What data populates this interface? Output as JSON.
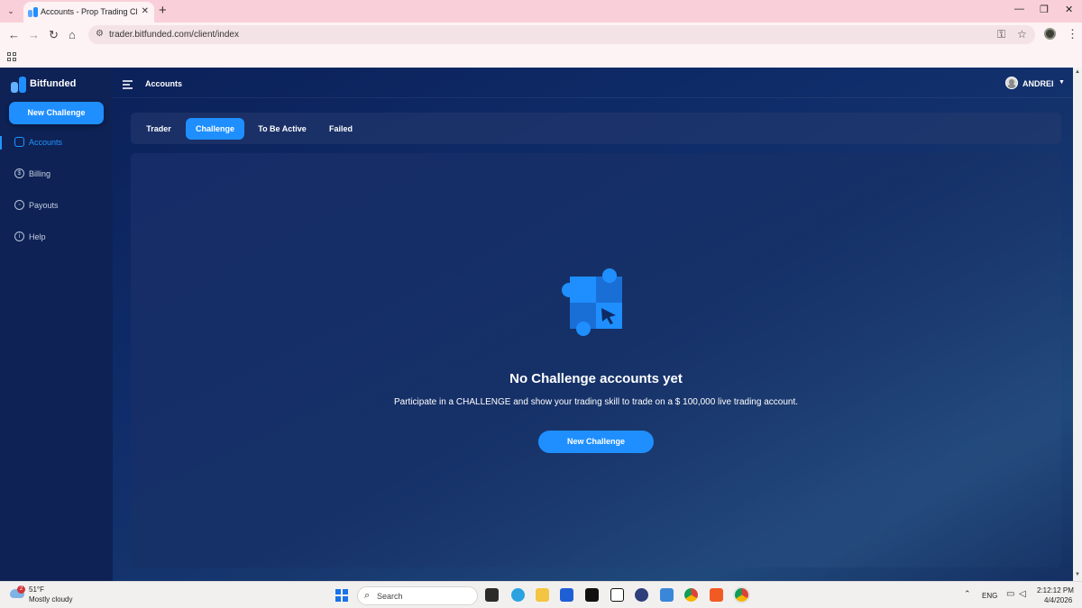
{
  "browser": {
    "tab_title": "Accounts - Prop Trading Client",
    "tab_close": "✕",
    "new_tab": "+",
    "url": "trader.bitfunded.com/client/index",
    "window_controls": [
      "—",
      "❐",
      "✕"
    ]
  },
  "app": {
    "brand": "Bitfunded",
    "sidebar": {
      "cta_label": "New Challenge",
      "items": [
        {
          "label": "Accounts",
          "icon": "wallet-icon",
          "active": true
        },
        {
          "label": "Billing",
          "icon": "dollar-icon",
          "active": false
        },
        {
          "label": "Payouts",
          "icon": "payout-icon",
          "active": false
        },
        {
          "label": "Help",
          "icon": "help-icon",
          "active": false
        }
      ]
    },
    "header": {
      "title": "Accounts",
      "user_name": "ANDREI"
    },
    "tabs": [
      {
        "label": "Trader",
        "active": false
      },
      {
        "label": "Challenge",
        "active": true
      },
      {
        "label": "To Be Active",
        "active": false
      },
      {
        "label": "Failed",
        "active": false
      }
    ],
    "empty_state": {
      "title": "No Challenge accounts yet",
      "subtitle": "Participate in a CHALLENGE and show your trading skill to trade on a $ 100,000 live trading account.",
      "cta_label": "New Challenge",
      "icon": "puzzle-cursor-icon"
    },
    "colors": {
      "accent": "#1f8fff",
      "background": "#0e2255"
    }
  },
  "taskbar": {
    "weather_temp": "51°F",
    "weather_condition": "Mostly cloudy",
    "weather_badge": "2",
    "search_label": "Search",
    "language": "ENG",
    "time": "2:12:12 PM",
    "date": "4/4/2026"
  }
}
